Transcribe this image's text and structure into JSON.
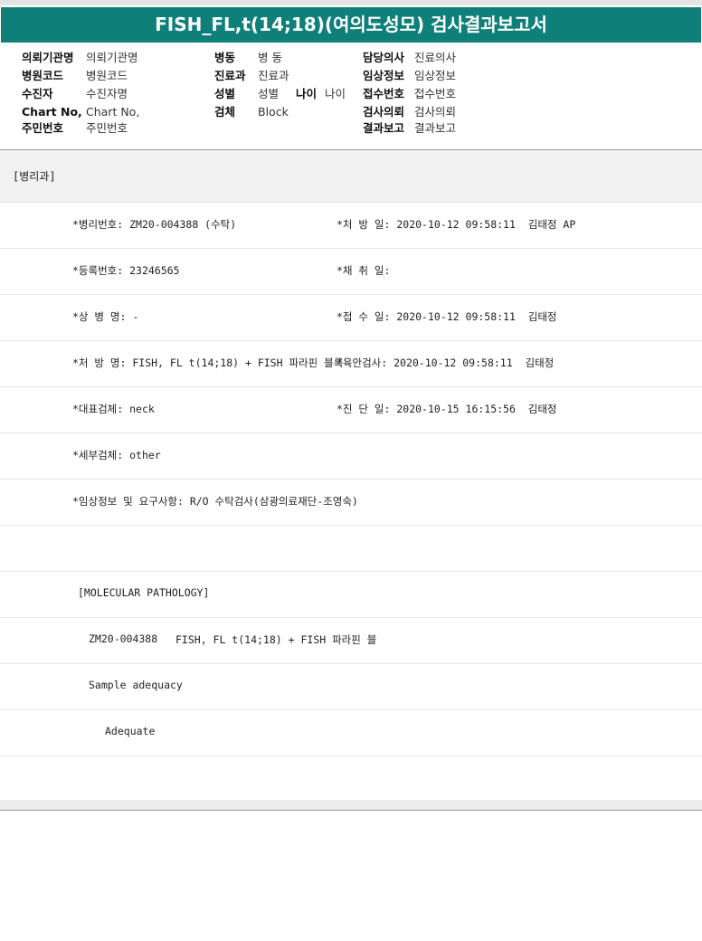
{
  "title": "FISH_FL,t(14;18)(여의도성모) 검사결과보고서",
  "header": {
    "col1": [
      {
        "label": "의뢰기관명",
        "value": "의뢰기관명"
      },
      {
        "label": "병원코드",
        "value": "병원코드"
      },
      {
        "label": "수진자",
        "value": "수진자명"
      },
      {
        "label": "Chart No,",
        "value": "Chart No,"
      },
      {
        "label": "주민번호",
        "value": "주민번호"
      }
    ],
    "col2": [
      {
        "label": "병동",
        "value": "병 동"
      },
      {
        "label": "진료과",
        "value": "진료과"
      },
      {
        "label": "성별",
        "value": "성별"
      },
      {
        "label": "검체",
        "value": "Block"
      }
    ],
    "age": {
      "label": "나이",
      "value": "나이"
    },
    "col3": [
      {
        "label": "담당의사",
        "value": "진료의사"
      },
      {
        "label": "임상정보",
        "value": "임상정보"
      },
      {
        "label": "접수번호",
        "value": "접수번호"
      },
      {
        "label": "검사의뢰",
        "value": "검사의뢰"
      },
      {
        "label": "결과보고",
        "value": "결과보고"
      }
    ]
  },
  "department": "[병리과]",
  "report": {
    "r1c1": "*병리번호: ZM20-004388 (수탁)",
    "r1c2": "*처 방 일: 2020-10-12 09:58:11  김태정 AP",
    "r2c1": "*등록번호: 23246565",
    "r2c2": "*채 취 일:",
    "r3c1": "*상 병 명: -",
    "r3c2": "*접 수 일: 2020-10-12 09:58:11  김태정",
    "r4c1": "*처 방 명: FISH, FL t(14;18) + FISH 파라핀 블록",
    "r4c2": "*육안검사: 2020-10-12 09:58:11  김태정",
    "r5c1": "*대표검체: neck",
    "r5c2": "*진 단 일: 2020-10-15 16:15:56  김태정",
    "r6c1": "*세부검체: other",
    "r7c1": "*임상정보 및 요구사항: R/O 수탁검사(삼광의료재단-조영숙)",
    "section": "[MOLECULAR PATHOLOGY]",
    "case_id": "ZM20-004388",
    "case_test": "FISH, FL t(14;18) + FISH 파라핀 블",
    "adequacy_label": "Sample adequacy",
    "adequacy_value": "Adequate"
  }
}
